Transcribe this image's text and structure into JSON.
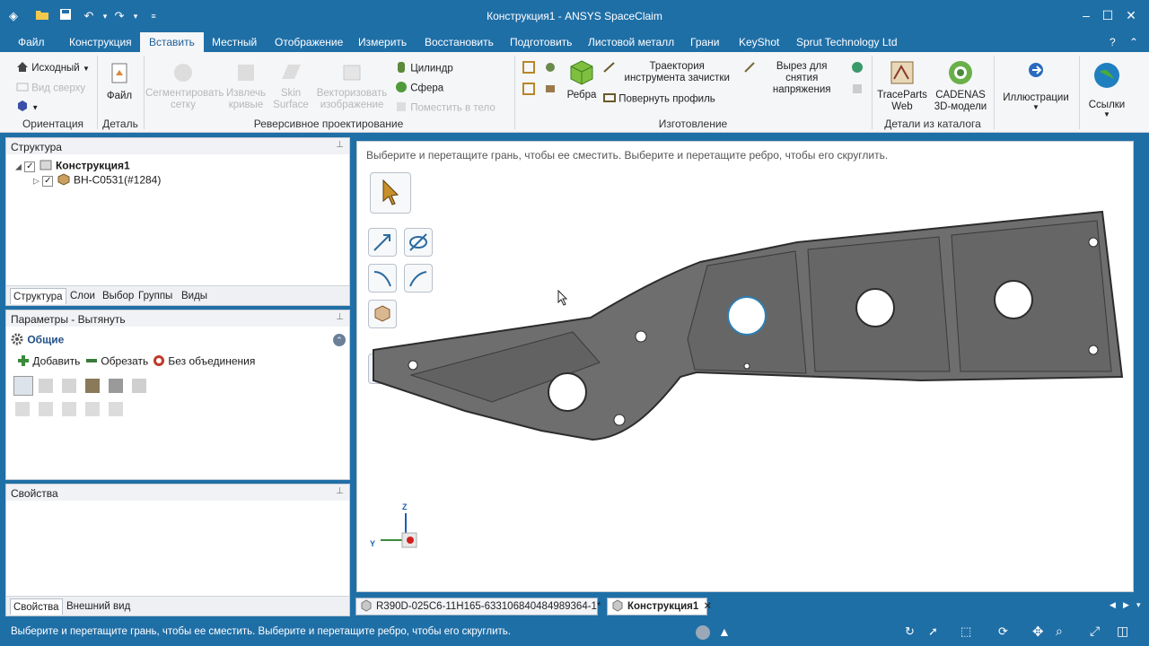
{
  "window": {
    "title": "Конструкция1 - ANSYS SpaceClaim",
    "minimize": "–",
    "restore": "☐",
    "close": "✕"
  },
  "quick_access": {
    "app_icon": "spaceclaim-icon",
    "open_icon": "folder-open-icon",
    "save_icon": "save-icon",
    "undo_icon": "undo-icon",
    "redo_icon": "redo-icon",
    "customize_icon": "customize-icon"
  },
  "menu": [
    "Файл",
    "Конструкция",
    "Вставить",
    "Местный",
    "Отображение",
    "Измерить",
    "Восстановить",
    "Подготовить",
    "Листовой металл",
    "Грани",
    "KeyShot",
    "Sprut Technology Ltd"
  ],
  "ribbon": {
    "orientation": {
      "home": "Исходный",
      "plan_view": "Вид сверху",
      "group": "Ориентация"
    },
    "detail": {
      "file": "Файл",
      "group": "Деталь"
    },
    "reverse": {
      "segment_mesh": "Сегментировать сетку",
      "extract_curves": "Извлечь кривые",
      "skin_surface": "Skin Surface",
      "vectorize_image": "Векторизовать изображение",
      "cylinder": "Цилиндр",
      "sphere": "Сфера",
      "fit_solid": "Поместить в тело",
      "group": "Реверсивное проектирование"
    },
    "manufacturing": {
      "ribs": "Ребра",
      "tool_path": "Траектория инструмента зачистки",
      "stress_cut": "Вырез для снятия напряжения",
      "rotate_profile": "Повернуть профиль",
      "group": "Изготовление"
    },
    "catalog": {
      "traceparts": "TraceParts Web",
      "cadenas": "CADENAS 3D-модели",
      "group": "Детали из каталога"
    },
    "illustrations": "Иллюстрации",
    "links": "Ссылки"
  },
  "structure_panel": {
    "title": "Структура",
    "root": "Конструкция1",
    "child": "BH-C0531(#1284)",
    "tabs": [
      "Структура",
      "Слои",
      "Выбор",
      "Группы",
      "Виды"
    ]
  },
  "options_panel": {
    "title": "Параметры - Вытянуть",
    "section": "Общие",
    "add": "Добавить",
    "cut": "Обрезать",
    "no_merge": "Без объединения"
  },
  "properties_panel": {
    "title": "Свойства",
    "tabs": [
      "Свойства",
      "Внешний вид"
    ]
  },
  "viewport": {
    "hint": "Выберите и перетащите грань, чтобы ее сместить. Выберите и перетащите ребро, чтобы его скруглить.",
    "axis_z": "Z",
    "axis_y": "Y"
  },
  "document_tabs": [
    {
      "label": "R390D-025C6-11H165-633106840484989364-1*",
      "active": false
    },
    {
      "label": "Конструкция1",
      "active": true
    }
  ],
  "status_text": "Выберите и перетащите грань, чтобы ее сместить. Выберите и перетащите ребро, чтобы его скруглить.",
  "colors": {
    "accent": "#1f6fa7",
    "part_fill": "#6e6e6e",
    "part_edge": "#2c2c2c"
  }
}
